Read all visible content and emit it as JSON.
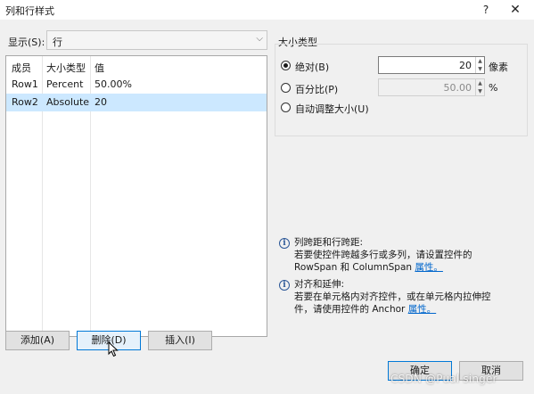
{
  "window": {
    "title": "列和行样式",
    "help_label": "?",
    "close_label": "✕"
  },
  "show": {
    "label": "显示(S):",
    "selected": "行",
    "arrow": "⌵"
  },
  "grid": {
    "headers": [
      "成员",
      "大小类型",
      "值"
    ],
    "rows": [
      {
        "member": "Row1",
        "size_type": "Percent",
        "value": "50.00%"
      },
      {
        "member": "Row2",
        "size_type": "Absolute",
        "value": "20"
      }
    ],
    "selected_index": 1
  },
  "buttons": {
    "add": "添加(A)",
    "delete": "删除(D)",
    "insert": "插入(I)",
    "ok": "确定",
    "cancel": "取消"
  },
  "size_type_group": {
    "label": "大小类型",
    "options": {
      "absolute": {
        "label": "绝对(B)",
        "value": "20",
        "unit": "像素",
        "selected": true
      },
      "percent": {
        "label": "百分比(P)",
        "value": "50.00",
        "unit": "%",
        "selected": false
      },
      "auto": {
        "label": "自动调整大小(U)",
        "selected": false
      }
    }
  },
  "info": {
    "span": {
      "title": "列跨距和行跨距:",
      "line1": "若要使控件跨越多行或多列，请设置控件的",
      "line2_prefix": "RowSpan 和 ColumnSpan ",
      "link": "属性。"
    },
    "align": {
      "title": "对齐和延伸:",
      "line1": "若要在单元格内对齐控件，或在单元格内拉伸控",
      "line2_prefix": "件，请使用控件的 Anchor ",
      "link": "属性。"
    }
  },
  "watermark": "CSDN @Pual singer",
  "colors": {
    "selection": "#cce8ff",
    "accent": "#0078d7",
    "link": "#0066cc"
  },
  "icons": {
    "info": "info-icon",
    "cursor": "mouse-pointer-icon"
  }
}
